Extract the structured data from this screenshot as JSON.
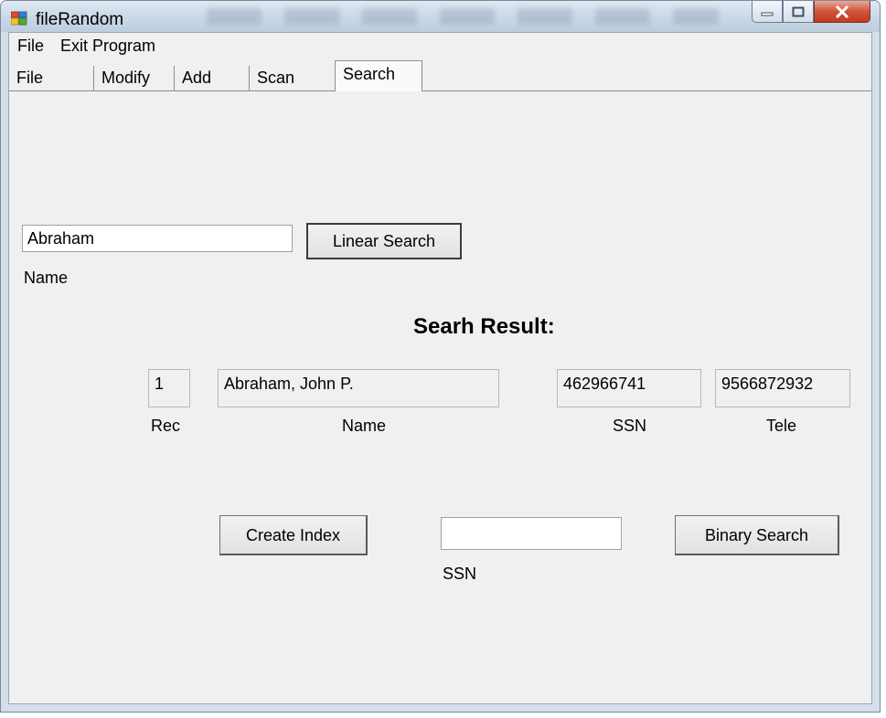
{
  "window": {
    "title": "fileRandom"
  },
  "menu": [
    "File",
    "Exit Program"
  ],
  "tabs": [
    {
      "label": "File"
    },
    {
      "label": "Modify"
    },
    {
      "label": "Add"
    },
    {
      "label": "Scan"
    },
    {
      "label": "Search",
      "selected": true
    }
  ],
  "linear": {
    "name_value": "Abraham",
    "name_label": "Name",
    "button_label": "Linear Search"
  },
  "result": {
    "heading": "Searh Result:",
    "rec_value": "1",
    "rec_label": "Rec",
    "name_value": "Abraham, John P.",
    "name_label": "Name",
    "ssn_value": "462966741",
    "ssn_label": "SSN",
    "tele_value": "9566872932",
    "tele_label": "Tele"
  },
  "binary": {
    "create_index_label": "Create Index",
    "ssn_value": "",
    "ssn_label": "SSN",
    "button_label": "Binary Search"
  },
  "colors": {
    "close_button": "#c23b21",
    "form_background": "#f0f0f0"
  }
}
